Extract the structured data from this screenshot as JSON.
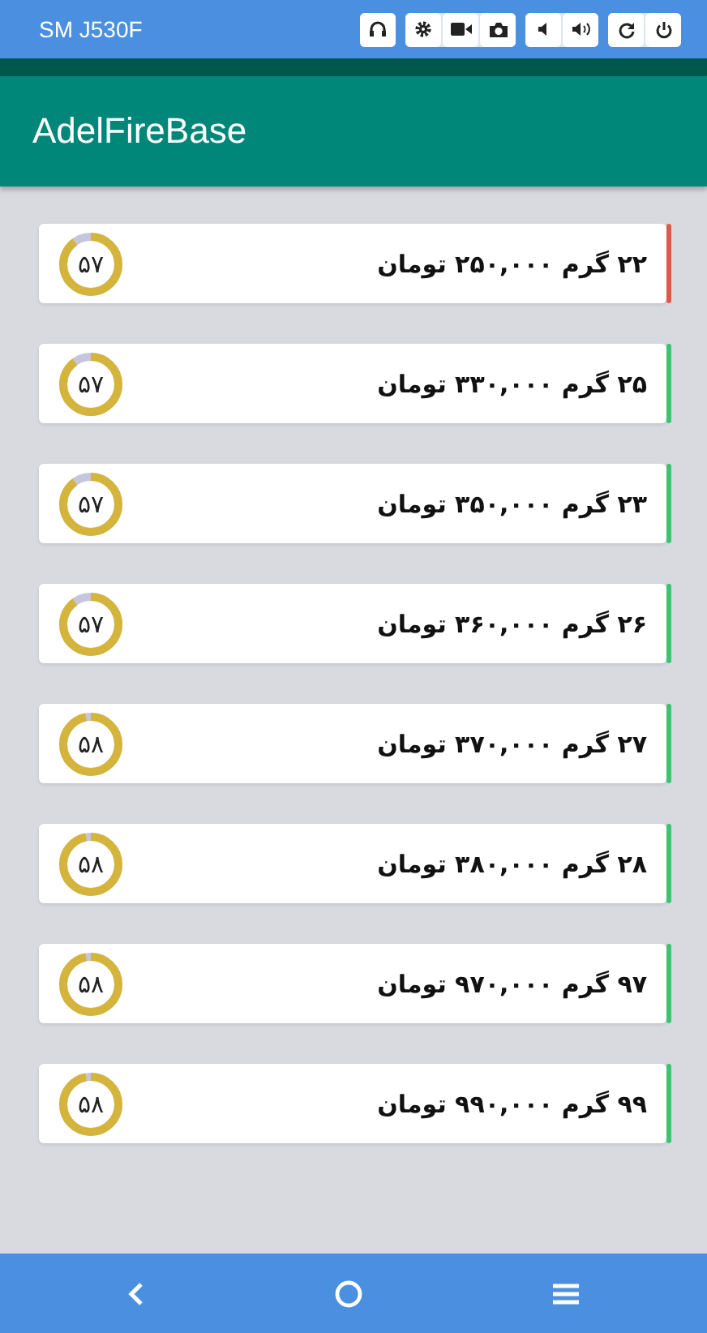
{
  "emulator_bar": {
    "device": "SM J530F"
  },
  "app_bar": {
    "title": "AdelFireBase"
  },
  "items": [
    {
      "text": "۲۲ گرم ۲۵۰,۰۰۰ تومان",
      "timer": "۵۷",
      "level": 0.9,
      "color": "#e0584a"
    },
    {
      "text": "۲۵ گرم ۳۳۰,۰۰۰ تومان",
      "timer": "۵۷",
      "level": 0.9,
      "color": "#3cc470"
    },
    {
      "text": "۲۳ گرم ۳۵۰,۰۰۰ تومان",
      "timer": "۵۷",
      "level": 0.9,
      "color": "#3cc470"
    },
    {
      "text": "۲۶ گرم ۳۶۰,۰۰۰ تومان",
      "timer": "۵۷",
      "level": 0.9,
      "color": "#3cc470"
    },
    {
      "text": "۲۷ گرم ۳۷۰,۰۰۰ تومان",
      "timer": "۵۸",
      "level": 0.97,
      "color": "#3cc470"
    },
    {
      "text": "۲۸ گرم ۳۸۰,۰۰۰ تومان",
      "timer": "۵۸",
      "level": 0.97,
      "color": "#3cc470"
    },
    {
      "text": "۹۷ گرم ۹۷۰,۰۰۰ تومان",
      "timer": "۵۸",
      "level": 0.97,
      "color": "#3cc470"
    },
    {
      "text": "۹۹ گرم ۹۹۰,۰۰۰ تومان",
      "timer": "۵۸",
      "level": 0.97,
      "color": "#3cc470"
    }
  ]
}
